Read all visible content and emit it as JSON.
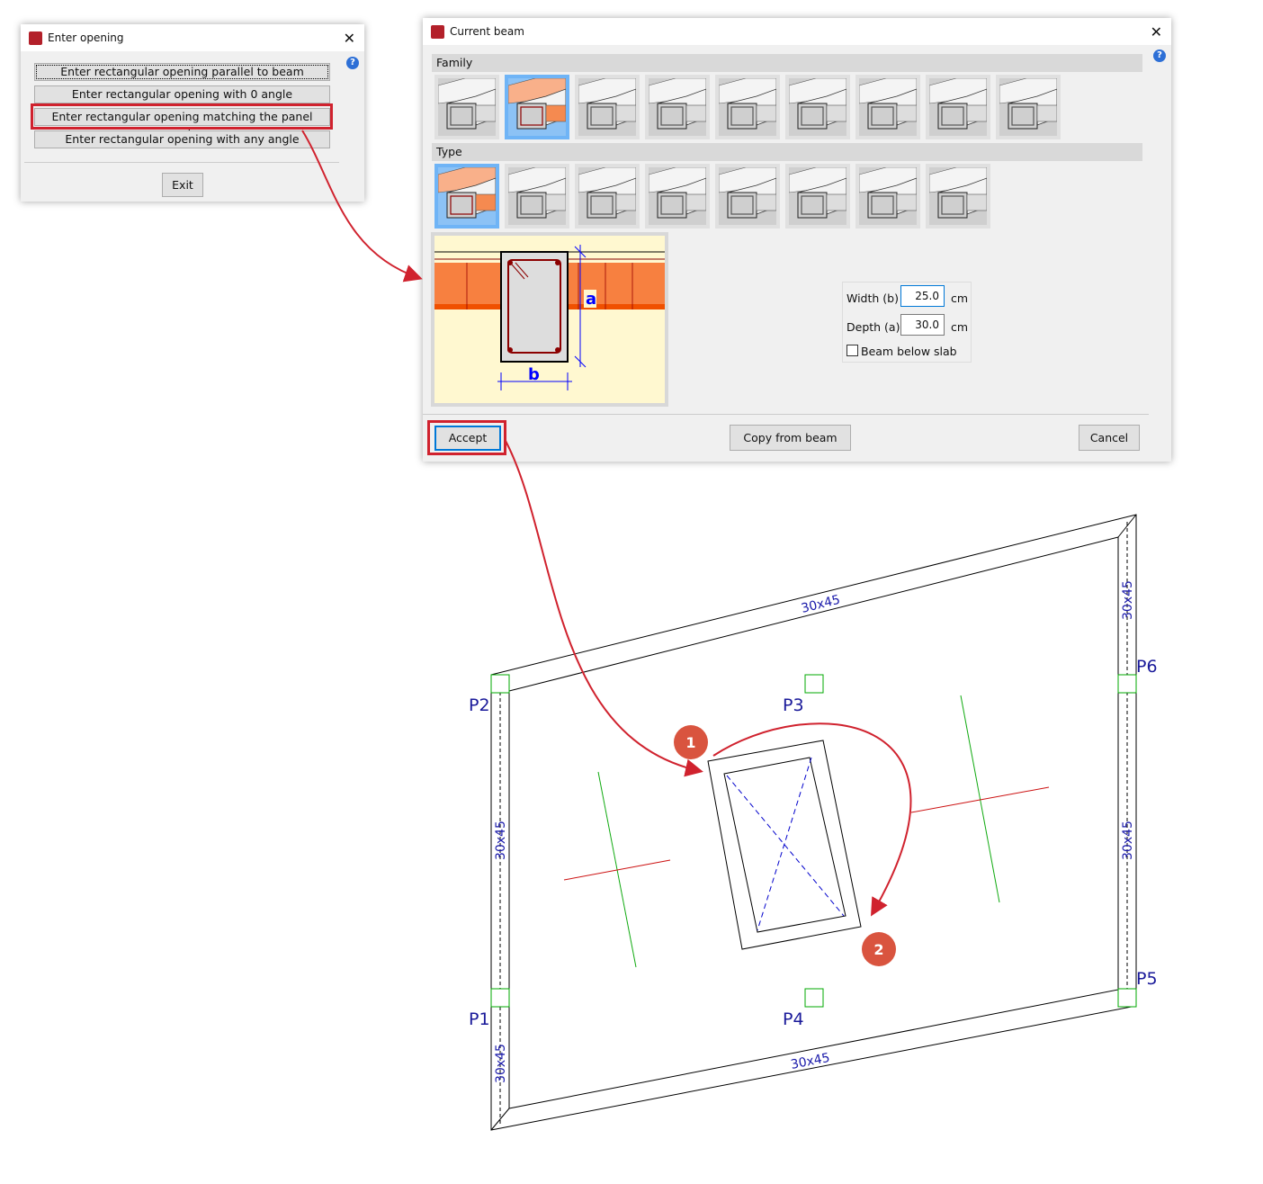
{
  "enter_opening": {
    "title": "Enter opening",
    "options": [
      "Enter rectangular opening parallel to beam",
      "Enter rectangular opening with 0 angle",
      "Enter rectangular opening matching the panel angle",
      "Enter rectangular opening with any angle"
    ],
    "highlighted_option": 2,
    "exit_label": "Exit"
  },
  "current_beam": {
    "title": "Current beam",
    "family_label": "Family",
    "type_label": "Type",
    "family_count": 9,
    "family_selected": 1,
    "type_count": 8,
    "type_selected": 0,
    "diagram": {
      "a_label": "a",
      "b_label": "b"
    },
    "width_label": "Width (b)",
    "width_value": "25.0",
    "width_unit": "cm",
    "depth_label": "Depth (a)",
    "depth_value": "30.0",
    "depth_unit": "cm",
    "below_slab_label": "Beam below slab",
    "below_slab_checked": false,
    "accept_label": "Accept",
    "copy_label": "Copy from beam",
    "cancel_label": "Cancel"
  },
  "drawing": {
    "columns": [
      "P1",
      "P2",
      "P3",
      "P4",
      "P5",
      "P6"
    ],
    "beam_labels": [
      "30x45",
      "30x45",
      "30x45",
      "30x45",
      "30x45",
      "30x45"
    ],
    "steps": [
      "1",
      "2"
    ],
    "accent": "#d9543f",
    "highlight": "#d0222e"
  }
}
